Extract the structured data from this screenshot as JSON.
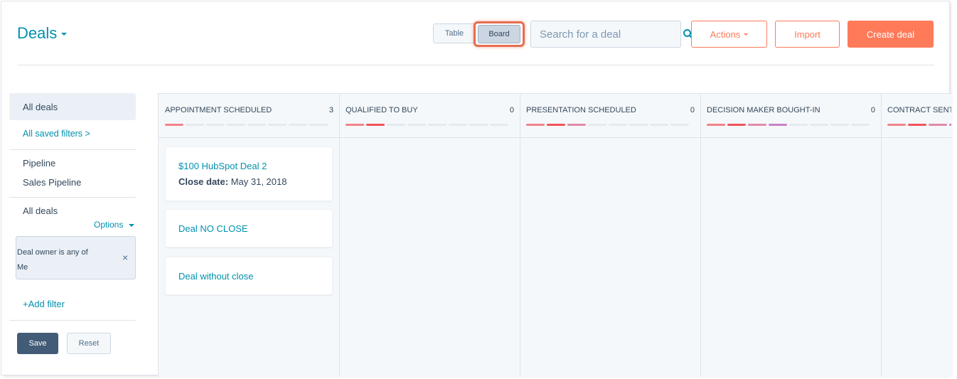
{
  "header": {
    "title": "Deals",
    "view_toggle": {
      "table_label": "Table",
      "board_label": "Board",
      "active": "Board"
    },
    "search_placeholder": "Search for a deal",
    "actions_label": "Actions",
    "import_label": "Import",
    "create_label": "Create deal"
  },
  "sidebar": {
    "all_deals": "All deals",
    "saved_filters": "All saved filters >",
    "pipeline_label": "Pipeline",
    "pipeline_value": "Sales Pipeline",
    "view_label": "All deals",
    "options_label": "Options",
    "filter": {
      "line1": "Deal owner is any of",
      "line2": "Me",
      "close": "×"
    },
    "add_filter": "+Add filter",
    "save_label": "Save",
    "reset_label": "Reset"
  },
  "board": {
    "columns": [
      {
        "title": "APPOINTMENT SCHEDULED",
        "count": "3",
        "filled": 1,
        "cards": [
          {
            "name": "$100 HubSpot Deal 2",
            "close_label": "Close date:",
            "close_value": "May 31, 2018"
          },
          {
            "name": "Deal NO CLOSE"
          },
          {
            "name": "Deal without close"
          }
        ]
      },
      {
        "title": "QUALIFIED TO BUY",
        "count": "0",
        "filled": 2,
        "cards": []
      },
      {
        "title": "PRESENTATION SCHEDULED",
        "count": "0",
        "filled": 3,
        "cards": []
      },
      {
        "title": "DECISION MAKER BOUGHT-IN",
        "count": "0",
        "filled": 4,
        "cards": []
      },
      {
        "title": "CONTRACT SENT",
        "count": "",
        "filled": 5,
        "cards": []
      }
    ]
  },
  "colors": {
    "accent": "#0091ae",
    "primary_button": "#ff7a59",
    "progress_pink": "#f2545b",
    "progress_purple": "#c882c8",
    "progress_empty": "#e5eaf0"
  }
}
